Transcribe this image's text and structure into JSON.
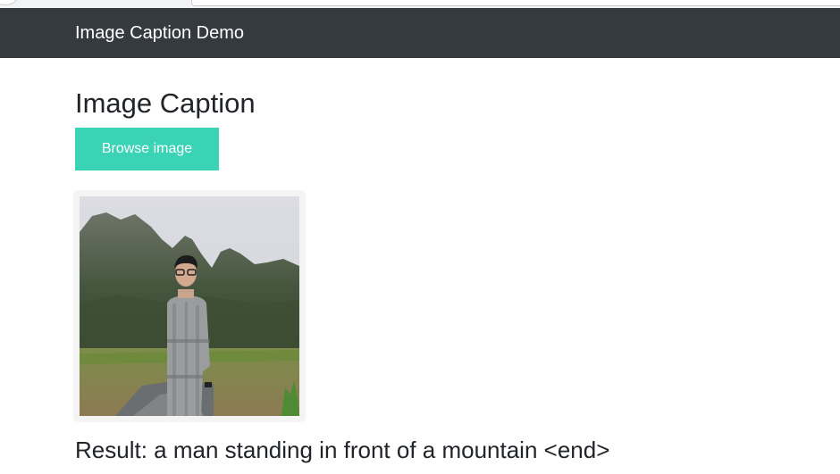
{
  "navbar": {
    "brand": "Image Caption Demo"
  },
  "main": {
    "title": "Image Caption",
    "browse_label": "Browse image",
    "result_prefix": "Result:",
    "caption": "a man standing in front of a mountain <end>"
  },
  "colors": {
    "navbar_bg": "#343a40",
    "button_bg": "#3ad3b5"
  }
}
